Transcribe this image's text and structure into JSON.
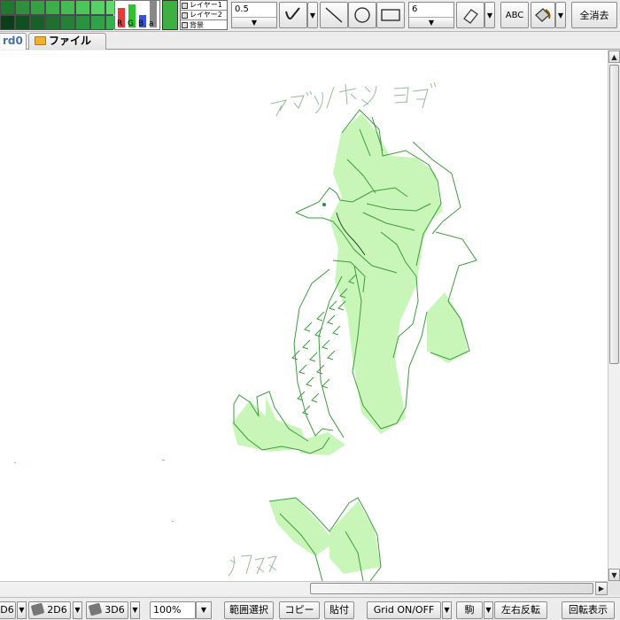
{
  "toolbar": {
    "palette_colors": [
      "#1e7a2e",
      "#2f8f3c",
      "#36a043",
      "#3daf4a",
      "#45bb52",
      "#4cc659",
      "#55d262",
      "#5fda6b",
      "#0c3f18",
      "#114f1f",
      "#176027",
      "#1d702e",
      "#238236",
      "#29923d",
      "#2fa345",
      "#36b04c"
    ],
    "rgb_labels": [
      "R",
      "G",
      "B",
      "a"
    ],
    "rgb_colors": [
      "#e23b3b",
      "#2fc12f",
      "#3a52d6",
      "#888888"
    ],
    "current_color": "#3faf3f",
    "layers": [
      "レイヤー1",
      "レイヤー2",
      "背景"
    ],
    "pen_size": "0.5",
    "brush_size": "6",
    "text_tool_label": "ABC",
    "clear_all_label": "全消去"
  },
  "tabs": [
    {
      "label": "rd0",
      "active": true
    },
    {
      "label": "ファイル",
      "active": false
    }
  ],
  "canvas": {
    "handwritten_title": "アマツノオトシゴ",
    "handwritten_label_2": "ワスス"
  },
  "bottom": {
    "die_1d6": "D6",
    "die_2d6": "2D6",
    "die_3d6": "3D6",
    "zoom": "100%",
    "range_select": "範囲選択",
    "copy": "コピー",
    "paste": "貼付",
    "grid": "Grid ON/OFF",
    "piece": "駒",
    "flip_horizontal": "左右反転",
    "rotate_display": "回転表示"
  }
}
